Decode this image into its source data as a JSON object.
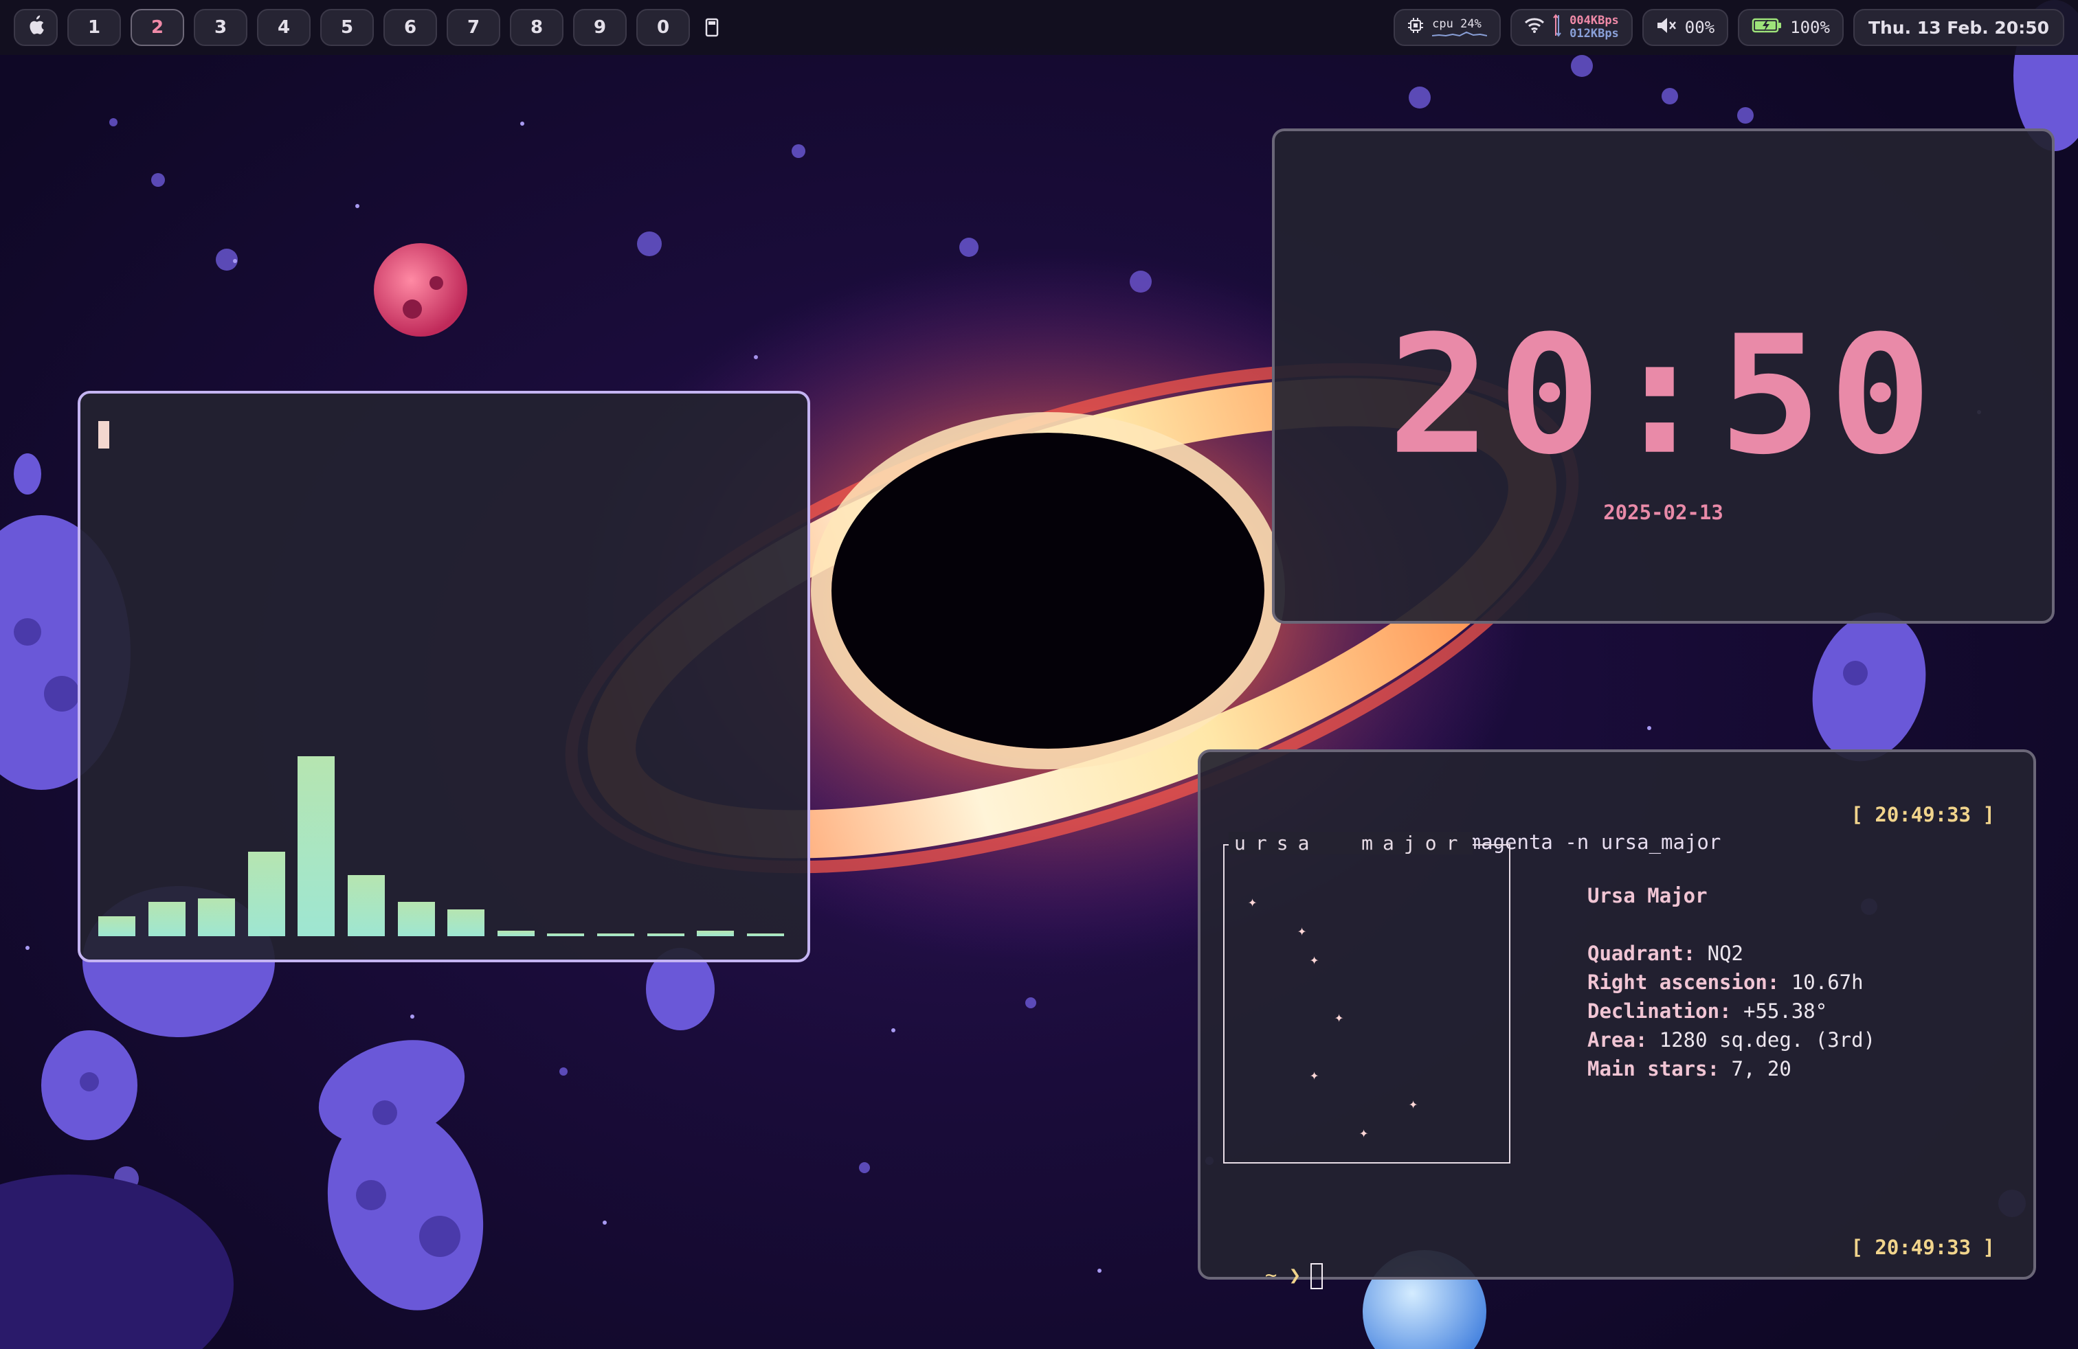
{
  "topbar": {
    "apple_icon": "apple-logo-icon",
    "workspaces": [
      "1",
      "2",
      "3",
      "4",
      "5",
      "6",
      "7",
      "8",
      "9",
      "0"
    ],
    "active_workspace": "2",
    "layout_icon": "window-layout-icon",
    "cpu": {
      "icon": "cpu-chip-icon",
      "label": "cpu",
      "value": "24%"
    },
    "network": {
      "icon": "wifi-icon",
      "up": "004KBps",
      "down": "012KBps"
    },
    "volume": {
      "icon": "speaker-muted-icon",
      "value": "00%"
    },
    "battery": {
      "icon": "battery-charging-icon",
      "value": "100%"
    },
    "datetime": "Thu. 13 Feb. 20:50"
  },
  "visualizer": {
    "levels": [
      0.11,
      0.19,
      0.21,
      0.47,
      1.0,
      0.34,
      0.19,
      0.15,
      0.03,
      0.015,
      0.015,
      0.015,
      0.03,
      0.015
    ]
  },
  "clock": {
    "time": "20:50",
    "date": "2025-02-13"
  },
  "terminal": {
    "prompt": "~ ❯",
    "command": "starfetch -c magenta -n ursa_major",
    "timestamp": "[ 20:49:33 ]",
    "box_title": "ursa  major",
    "star_glyph": "✦",
    "name": "Ursa Major",
    "fields": [
      {
        "key": "Quadrant",
        "value": "NQ2"
      },
      {
        "key": "Right ascension",
        "value": "10.67h"
      },
      {
        "key": "Declination",
        "value": "+55.38°"
      },
      {
        "key": "Area",
        "value": "1280 sq.deg. (3rd)"
      },
      {
        "key": "Main stars",
        "value": "7, 20"
      }
    ],
    "bottom_timestamp": "[ 20:49:33 ]"
  },
  "colors": {
    "accent_pink": "#e98aa8",
    "accent_yellow": "#f1d48c",
    "focus_border": "#c4b4f2",
    "bar_green": "#9ee6d2"
  }
}
